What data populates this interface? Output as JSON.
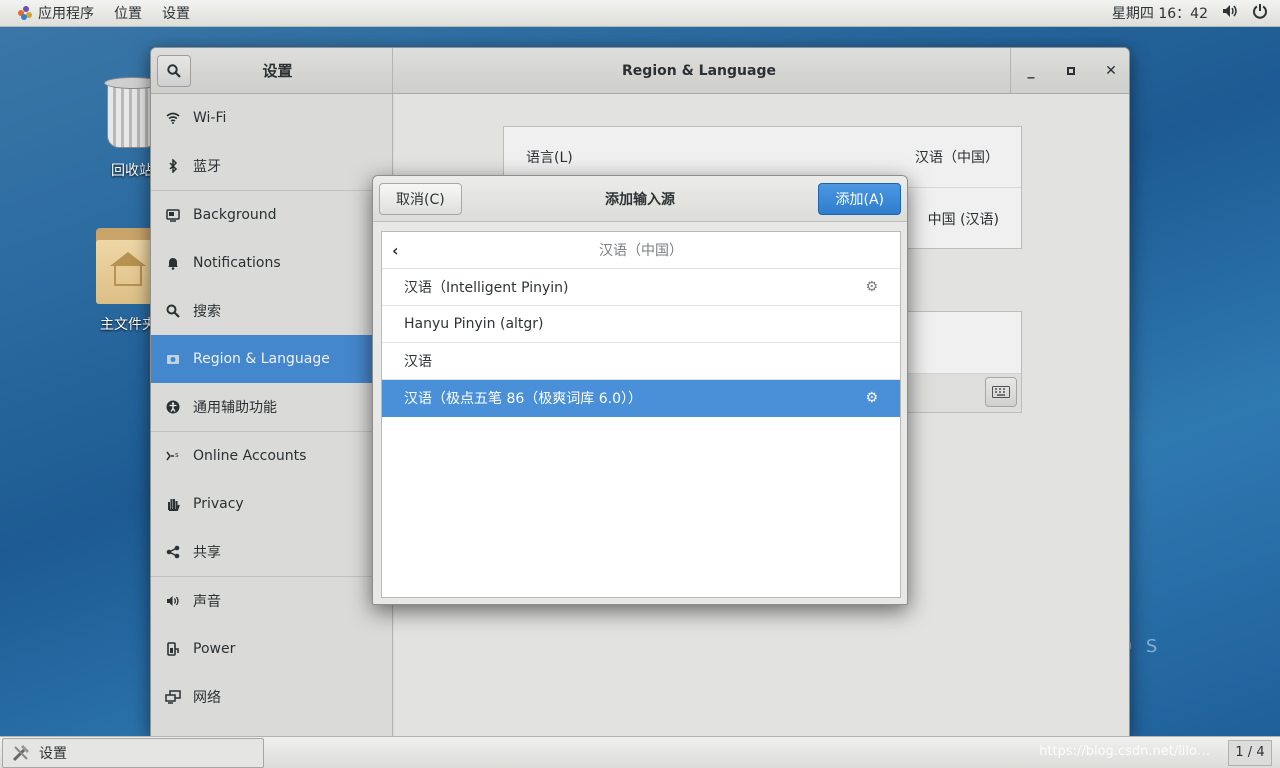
{
  "top_panel": {
    "apps_label": "应用程序",
    "places_label": "位置",
    "settings_label": "设置",
    "clock": "星期四 16：42"
  },
  "desktop": {
    "trash_label": "回收站",
    "home_label": "主文件夹",
    "watermark_fragment": "O S"
  },
  "settings": {
    "sidebar_title": "设置",
    "panel_title": "Region & Language",
    "sidebar_items": [
      {
        "label": "Wi-Fi",
        "icon": "wifi-icon"
      },
      {
        "label": "蓝牙",
        "icon": "bluetooth-icon"
      },
      {
        "label": "Background",
        "icon": "background-icon"
      },
      {
        "label": "Notifications",
        "icon": "bell-icon"
      },
      {
        "label": "搜索",
        "icon": "search-icon"
      },
      {
        "label": "Region & Language",
        "icon": "region-icon"
      },
      {
        "label": "通用辅助功能",
        "icon": "accessibility-icon"
      },
      {
        "label": "Online Accounts",
        "icon": "online-accounts-icon"
      },
      {
        "label": "Privacy",
        "icon": "hand-icon"
      },
      {
        "label": "共享",
        "icon": "share-icon"
      },
      {
        "label": "声音",
        "icon": "speaker-icon"
      },
      {
        "label": "Power",
        "icon": "power-plug-icon"
      },
      {
        "label": "网络",
        "icon": "network-icon"
      }
    ],
    "language_label": "语言(L)",
    "language_value": "汉语（中国）",
    "formats_value": "中国 (汉语)"
  },
  "dialog": {
    "title": "添加输入源",
    "cancel_label": "取消(C)",
    "add_label": "添加(A)",
    "list_header": "汉语（中国）",
    "rows": [
      {
        "label": "汉语（Intelligent Pinyin)",
        "has_gear": true
      },
      {
        "label": "Hanyu Pinyin (altgr)",
        "has_gear": false
      },
      {
        "label": "汉语",
        "has_gear": false
      },
      {
        "label": "汉语（极点五笔 86（极爽词库 6.0））",
        "has_gear": true
      }
    ]
  },
  "taskbar": {
    "task_label": "设置",
    "workspace": "1 / 4",
    "watermark": "https://blog.csdn.net/lilo…"
  },
  "colors": {
    "accent": "#4a90d9",
    "desktop": "#2a6aa0"
  }
}
